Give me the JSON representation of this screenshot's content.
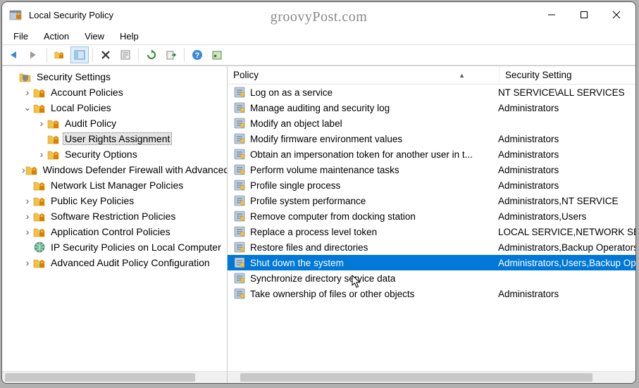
{
  "title": "Local Security Policy",
  "watermark": "groovyPost.com",
  "menu": {
    "file": "File",
    "action": "Action",
    "view": "View",
    "help": "Help"
  },
  "tree_root": "Security Settings",
  "tree": {
    "account_policies": "Account Policies",
    "local_policies": "Local Policies",
    "audit_policy": "Audit Policy",
    "user_rights": "User Rights Assignment",
    "security_options": "Security Options",
    "firewall": "Windows Defender Firewall with Advanced Security",
    "network_list": "Network List Manager Policies",
    "public_key": "Public Key Policies",
    "software_restriction": "Software Restriction Policies",
    "app_control": "Application Control Policies",
    "ipsec": "IP Security Policies on Local Computer",
    "advanced_audit": "Advanced Audit Policy Configuration"
  },
  "columns": {
    "policy": "Policy",
    "setting": "Security Setting"
  },
  "policies": [
    {
      "name": "Log on as a service",
      "setting": "NT SERVICE\\ALL SERVICES"
    },
    {
      "name": "Manage auditing and security log",
      "setting": "Administrators"
    },
    {
      "name": "Modify an object label",
      "setting": ""
    },
    {
      "name": "Modify firmware environment values",
      "setting": "Administrators"
    },
    {
      "name": "Obtain an impersonation token for another user in t...",
      "setting": "Administrators"
    },
    {
      "name": "Perform volume maintenance tasks",
      "setting": "Administrators"
    },
    {
      "name": "Profile single process",
      "setting": "Administrators"
    },
    {
      "name": "Profile system performance",
      "setting": "Administrators,NT SERVICE"
    },
    {
      "name": "Remove computer from docking station",
      "setting": "Administrators,Users"
    },
    {
      "name": "Replace a process level token",
      "setting": "LOCAL SERVICE,NETWORK SERVICE"
    },
    {
      "name": "Restore files and directories",
      "setting": "Administrators,Backup Operators"
    },
    {
      "name": "Shut down the system",
      "setting": "Administrators,Users,Backup Operators"
    },
    {
      "name": "Synchronize directory service data",
      "setting": ""
    },
    {
      "name": "Take ownership of files or other objects",
      "setting": "Administrators"
    }
  ],
  "selected_policy_index": 11
}
